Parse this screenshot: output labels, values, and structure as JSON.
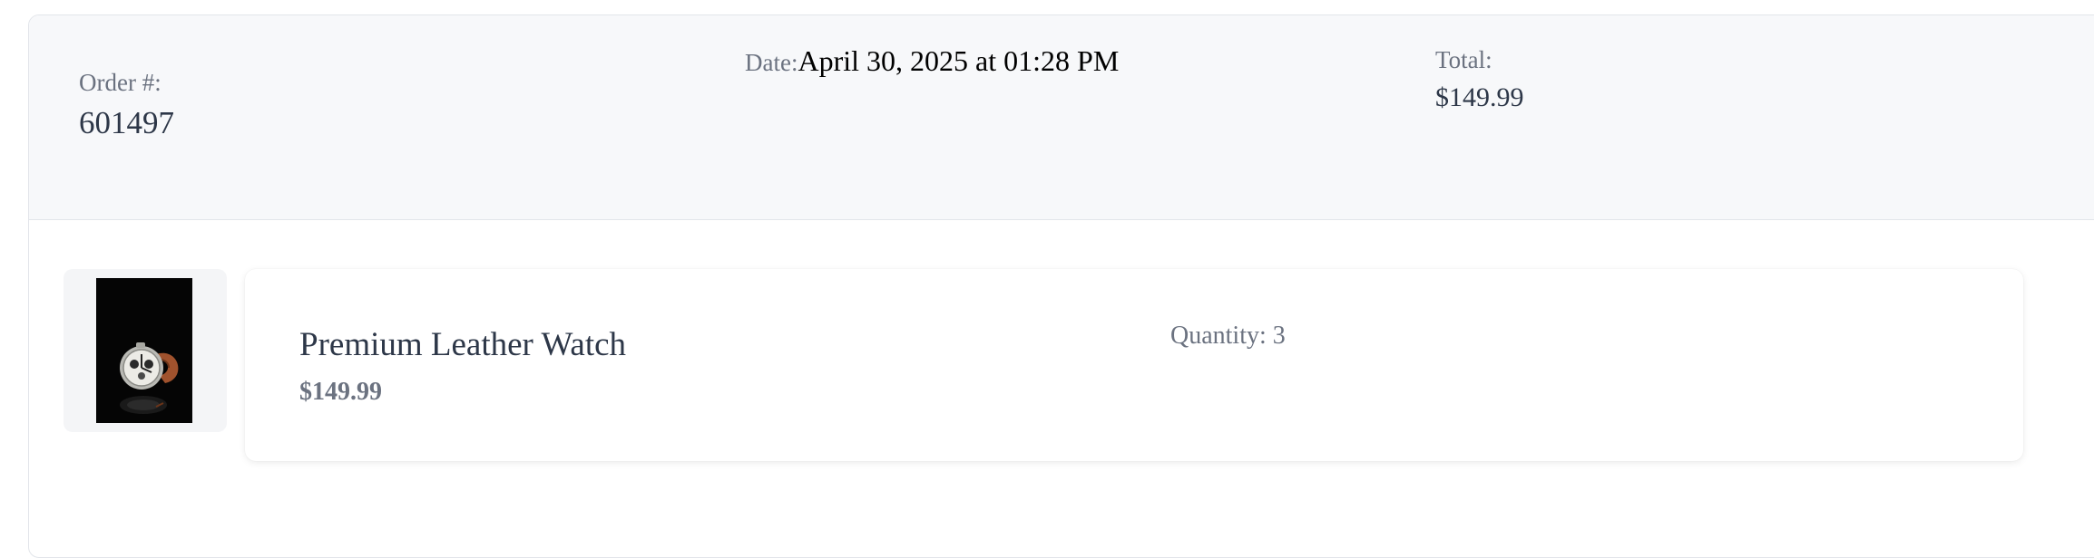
{
  "order": {
    "number_label": "Order #:",
    "number_value": "601497",
    "date_label": "Date:",
    "date_value": "April 30, 2025 at 01:28 PM",
    "total_label": "Total:",
    "total_value": "$149.99"
  },
  "items": [
    {
      "name": "Premium Leather Watch",
      "price": "$149.99",
      "quantity_label": "Quantity: ",
      "quantity_value": "3",
      "image_icon": "watch-icon"
    }
  ],
  "colors": {
    "header_bg": "#f7f8fa",
    "border": "#e2e5ea",
    "label_text": "#6b7280",
    "value_text": "#2d3748",
    "thumb_bg": "#050505"
  }
}
